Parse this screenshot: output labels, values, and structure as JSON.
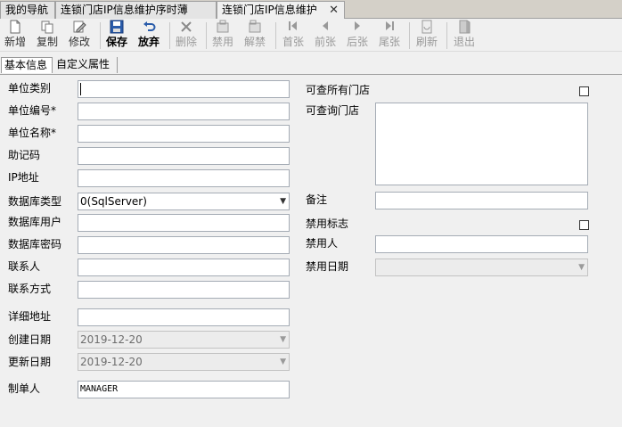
{
  "tabs": [
    {
      "label": "我的导航"
    },
    {
      "label": "连锁门店IP信息维护序时薄"
    },
    {
      "label": "连锁门店IP信息维护",
      "close": "✕"
    }
  ],
  "toolbar": {
    "new": {
      "label": "新增",
      "icon": "new-doc-icon"
    },
    "copy": {
      "label": "复制",
      "icon": "copy-icon"
    },
    "edit": {
      "label": "修改",
      "icon": "edit-icon"
    },
    "save": {
      "label": "保存",
      "icon": "save-icon"
    },
    "undo": {
      "label": "放弃",
      "icon": "undo-icon"
    },
    "delete": {
      "label": "删除",
      "icon": "delete-icon"
    },
    "disable": {
      "label": "禁用",
      "icon": "disable-icon"
    },
    "enable": {
      "label": "解禁",
      "icon": "enable-icon"
    },
    "first": {
      "label": "首张",
      "icon": "first-icon"
    },
    "prev": {
      "label": "前张",
      "icon": "prev-icon"
    },
    "next": {
      "label": "后张",
      "icon": "next-icon"
    },
    "last": {
      "label": "尾张",
      "icon": "last-icon"
    },
    "refresh": {
      "label": "刷新",
      "icon": "refresh-icon"
    },
    "exit": {
      "label": "退出",
      "icon": "exit-icon"
    }
  },
  "subtabs": [
    {
      "label": "基本信息"
    },
    {
      "label": "自定义属性"
    }
  ],
  "form": {
    "unit_category": {
      "label": "单位类别",
      "value": ""
    },
    "unit_code": {
      "label": "单位编号*",
      "value": ""
    },
    "unit_name": {
      "label": "单位名称*",
      "value": ""
    },
    "mnemonic": {
      "label": "助记码",
      "value": ""
    },
    "ip_address": {
      "label": "IP地址",
      "value": ""
    },
    "db_type": {
      "label": "数据库类型",
      "value": "0(SqlServer)"
    },
    "db_user": {
      "label": "数据库用户",
      "value": ""
    },
    "db_password": {
      "label": "数据库密码",
      "value": ""
    },
    "contact": {
      "label": "联系人",
      "value": ""
    },
    "contact_info": {
      "label": "联系方式",
      "value": ""
    },
    "address": {
      "label": "详细地址",
      "value": ""
    },
    "created_date": {
      "label": "创建日期",
      "value": "2019-12-20"
    },
    "updated_date": {
      "label": "更新日期",
      "value": "2019-12-20"
    },
    "creator": {
      "label": "制单人",
      "value": "MANAGER"
    },
    "query_all_stores": {
      "label": "可查所有门店",
      "checked": false
    },
    "queryable_stores": {
      "label": "可查询门店",
      "value": ""
    },
    "remark": {
      "label": "备注",
      "value": ""
    },
    "disabled_flag": {
      "label": "禁用标志",
      "checked": false
    },
    "disabled_by": {
      "label": "禁用人",
      "value": ""
    },
    "disabled_date": {
      "label": "禁用日期",
      "value": ""
    }
  }
}
